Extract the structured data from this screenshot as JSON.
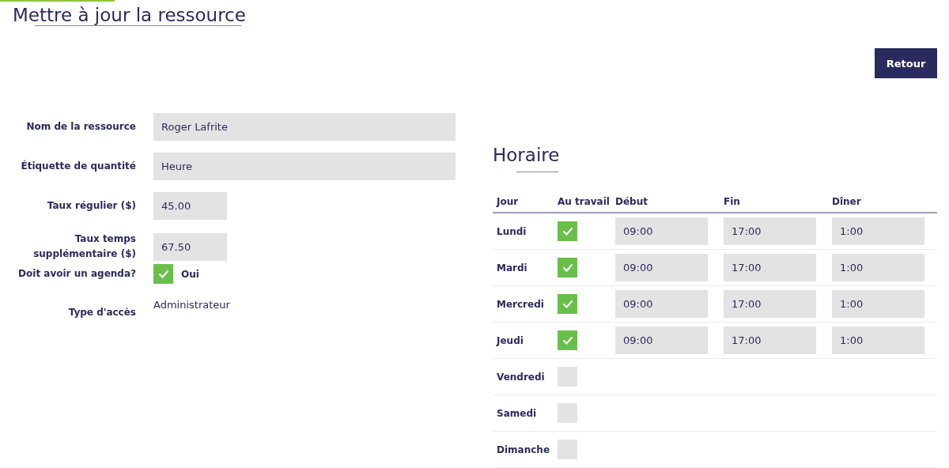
{
  "page": {
    "title": "Mettre à jour la ressource",
    "back_button": "Retour"
  },
  "form": {
    "fields": [
      {
        "kind": "text",
        "label": "Nom de la ressource",
        "value": "Roger Lafrite"
      },
      {
        "kind": "text",
        "label": "Étiquette de quantité",
        "value": "Heure"
      },
      {
        "kind": "amount",
        "label": "Taux régulier ($)",
        "value": "45.00"
      },
      {
        "kind": "amount",
        "label": "Taux temps supplémentaire ($)",
        "value": "67.50"
      },
      {
        "kind": "checkbox",
        "label": "Doit avoir un agenda?",
        "checked": true,
        "option": "Oui"
      },
      {
        "kind": "static",
        "label": "Type d'accès",
        "value": "Administrateur"
      }
    ]
  },
  "schedule": {
    "title": "Horaire",
    "columns": [
      "Jour",
      "Au travail",
      "Début",
      "Fin",
      "Dîner"
    ],
    "rows": [
      {
        "day": "Lundi",
        "working": true,
        "start": "09:00",
        "end": "17:00",
        "lunch": "1:00"
      },
      {
        "day": "Mardi",
        "working": true,
        "start": "09:00",
        "end": "17:00",
        "lunch": "1:00"
      },
      {
        "day": "Mercredi",
        "working": true,
        "start": "09:00",
        "end": "17:00",
        "lunch": "1:00"
      },
      {
        "day": "Jeudi",
        "working": true,
        "start": "09:00",
        "end": "17:00",
        "lunch": "1:00"
      },
      {
        "day": "Vendredi",
        "working": false
      },
      {
        "day": "Samedi",
        "working": false
      },
      {
        "day": "Dimanche",
        "working": false
      }
    ]
  }
}
